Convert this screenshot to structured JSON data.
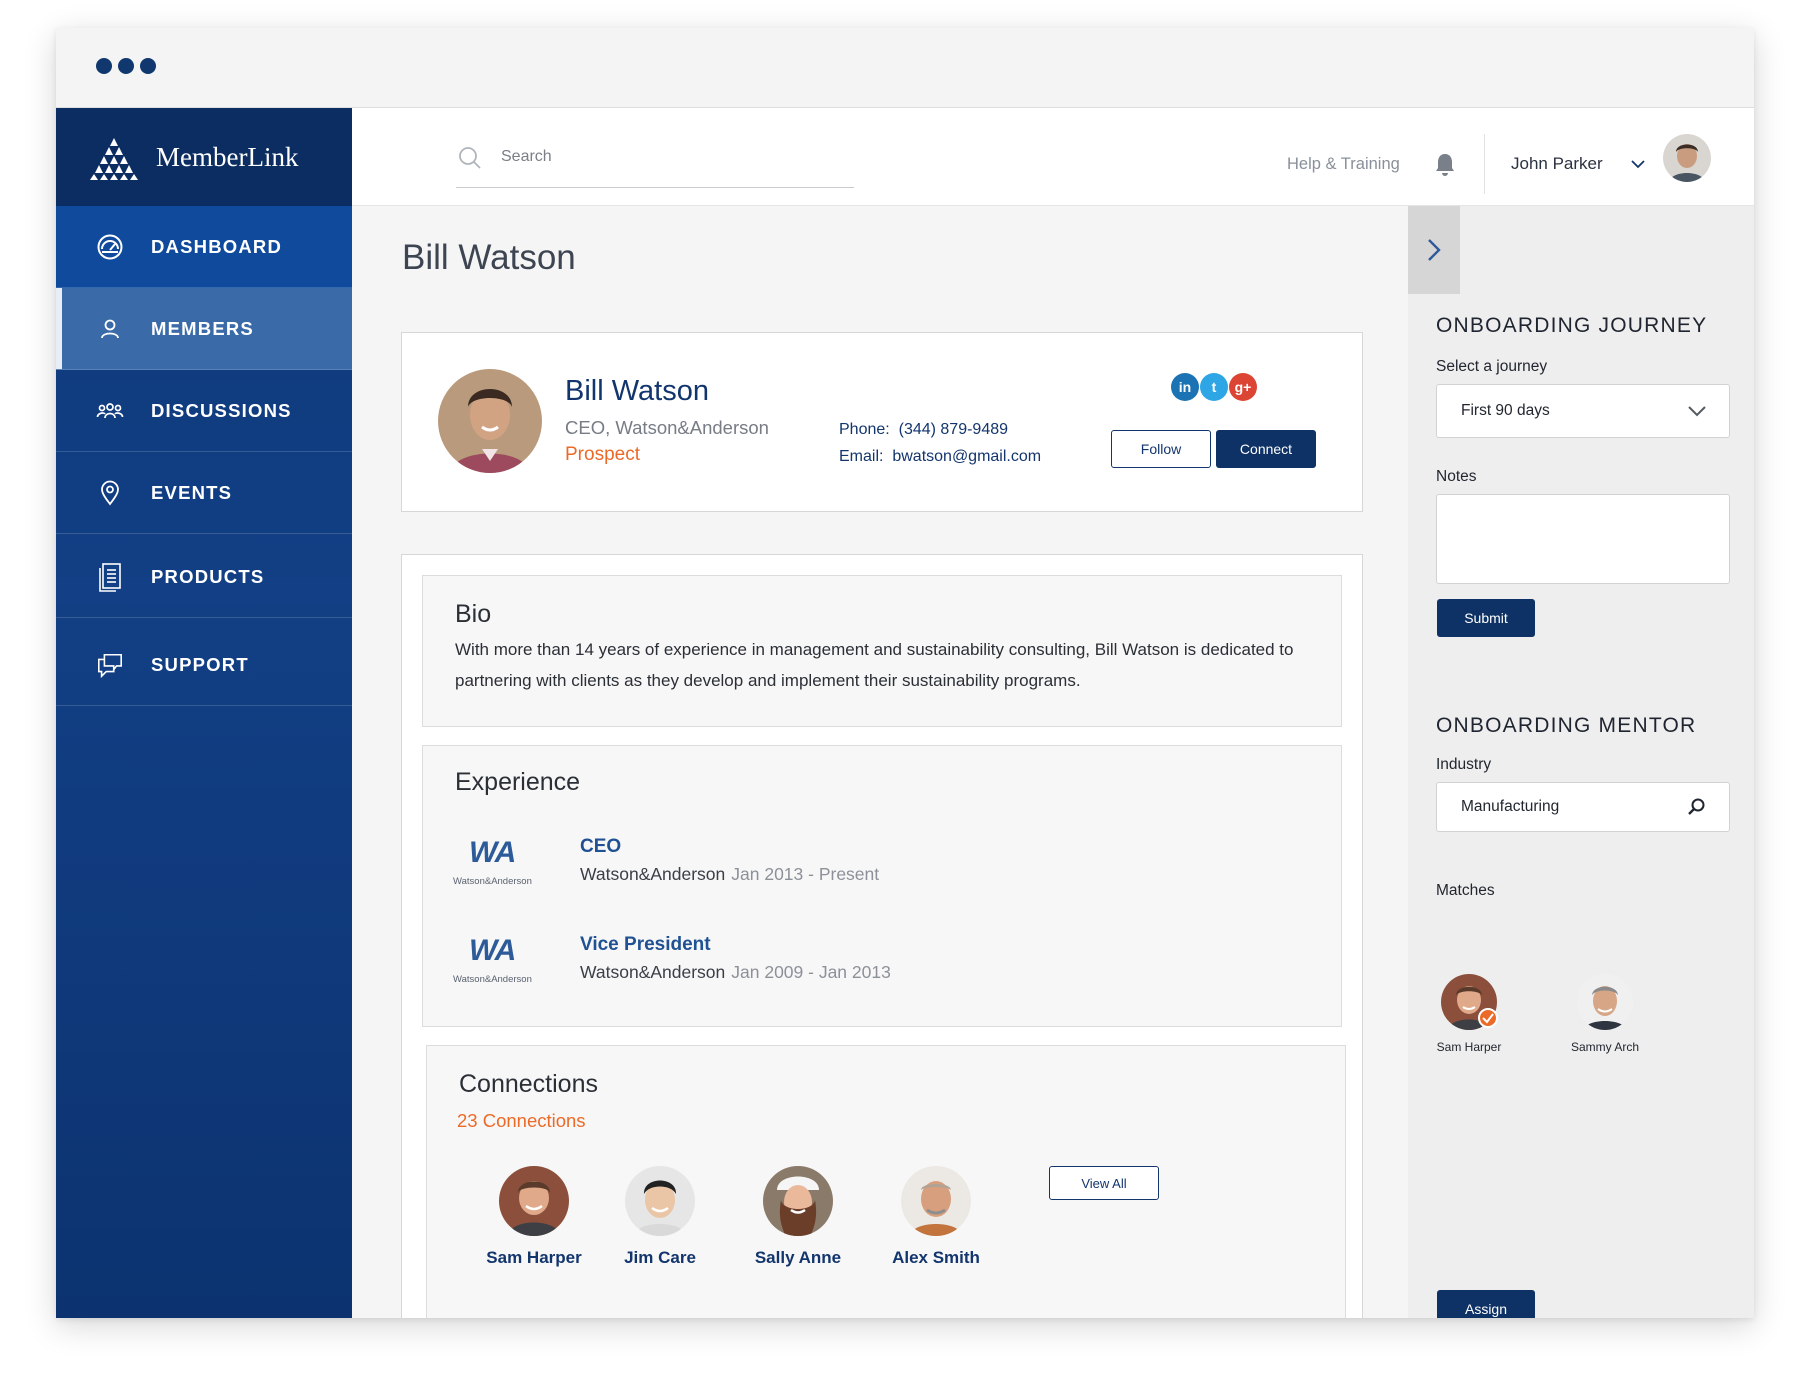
{
  "brand": {
    "name": "MemberLink"
  },
  "nav": {
    "items": [
      {
        "label": "DASHBOARD",
        "icon": "dashboard-icon"
      },
      {
        "label": "MEMBERS",
        "icon": "user-icon"
      },
      {
        "label": "DISCUSSIONS",
        "icon": "group-icon"
      },
      {
        "label": "EVENTS",
        "icon": "location-pin-icon"
      },
      {
        "label": "PRODUCTS",
        "icon": "document-icon"
      },
      {
        "label": "SUPPORT",
        "icon": "chat-icon"
      }
    ]
  },
  "topbar": {
    "search_placeholder": "Search",
    "help_label": "Help & Training",
    "user_name": "John Parker"
  },
  "page": {
    "title": "Bill Watson"
  },
  "profile": {
    "name": "Bill Watson",
    "role": "CEO, Watson&Anderson",
    "status": "Prospect",
    "phone_label": "Phone:",
    "phone": "(344) 879-9489",
    "email_label": "Email:",
    "email": "bwatson@gmail.com",
    "social": [
      {
        "name": "linkedin-icon",
        "glyph": "in",
        "color": "#1b73b3"
      },
      {
        "name": "twitter-icon",
        "glyph": "t",
        "color": "#2ea6e6"
      },
      {
        "name": "google-plus-icon",
        "glyph": "g+",
        "color": "#dc4533"
      }
    ],
    "follow_label": "Follow",
    "connect_label": "Connect"
  },
  "bio": {
    "title": "Bio",
    "text": "With more than 14 years of experience in management and sustainability consulting,  Bill Watson is dedicated to partnering with clients as they develop and implement their sustainability programs."
  },
  "experience": {
    "title": "Experience",
    "items": [
      {
        "logo": "WA",
        "logo_sub": "Watson&Anderson",
        "title": "CEO",
        "company": "Watson&Anderson",
        "dates": "Jan 2013 - Present"
      },
      {
        "logo": "WA",
        "logo_sub": "Watson&Anderson",
        "title": "Vice President",
        "company": "Watson&Anderson",
        "dates": "Jan 2009 - Jan 2013"
      }
    ]
  },
  "connections": {
    "title": "Connections",
    "count_label": "23 Connections",
    "people": [
      {
        "name": "Sam Harper"
      },
      {
        "name": "Jim Care"
      },
      {
        "name": "Sally Anne"
      },
      {
        "name": "Alex Smith"
      }
    ],
    "view_all_label": "View All"
  },
  "onboarding": {
    "journey_title": "ONBOARDING JOURNEY",
    "select_label": "Select a journey",
    "selected_journey": "First 90 days",
    "notes_label": "Notes",
    "notes_value": "",
    "submit_label": "Submit",
    "mentor_title": "ONBOARDING MENTOR",
    "industry_label": "Industry",
    "industry_value": "Manufacturing",
    "matches_label": "Matches",
    "matches": [
      {
        "name": "Sam Harper"
      },
      {
        "name": "Sammy Arch"
      }
    ],
    "assign_label": "Assign"
  },
  "colors": {
    "primary": "#0e3265",
    "sidebar": "#123f85",
    "accent": "#ec6a28",
    "link": "#1f5193"
  }
}
